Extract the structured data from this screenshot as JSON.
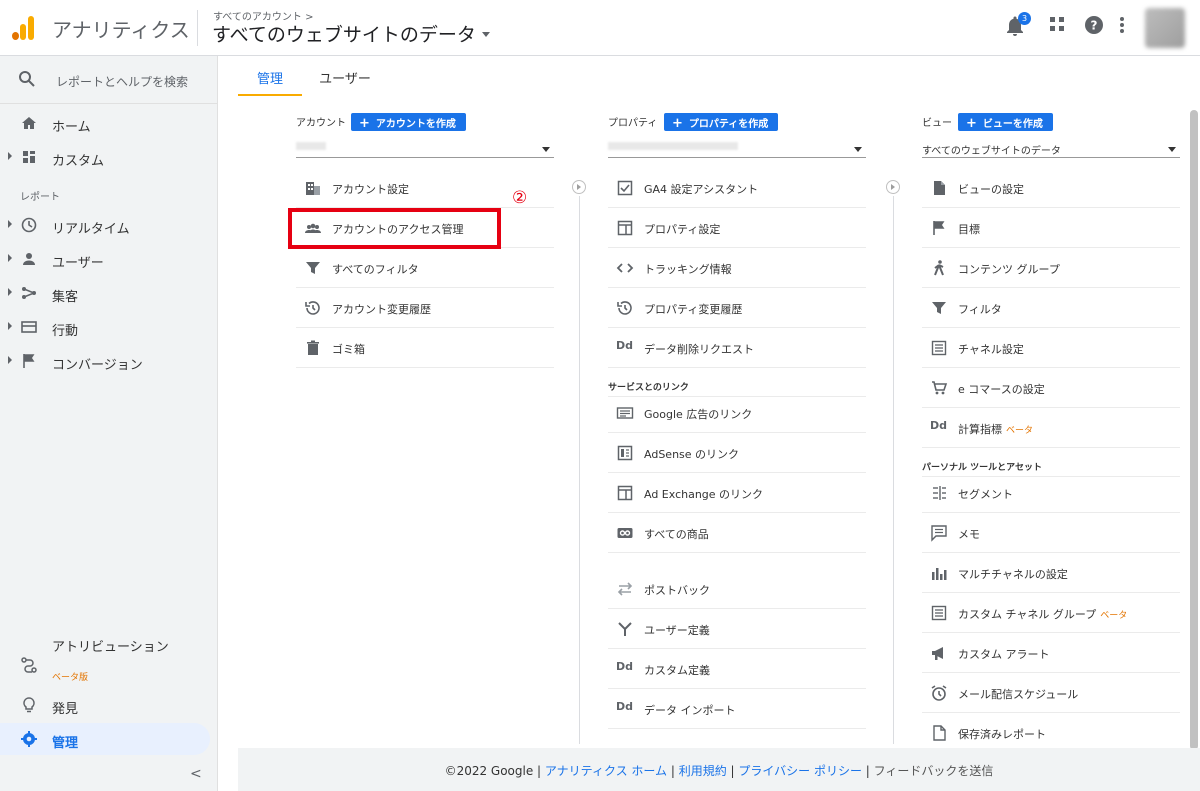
{
  "header": {
    "app_title": "アナリティクス",
    "breadcrumb": "すべてのアカウント >",
    "view_title": "すべてのウェブサイトのデータ",
    "notifications_count": "3",
    "colors": {
      "accent": "#1a73e8",
      "brand_orange": "#f9ab00",
      "brand_dark_orange": "#e37400"
    }
  },
  "sidebar": {
    "search_label": "レポートとヘルプを検索",
    "top_items": [
      {
        "label": "ホーム",
        "icon": "home-icon"
      },
      {
        "label": "カスタム",
        "icon": "dashboard-icon"
      }
    ],
    "reports_label": "レポート",
    "report_items": [
      {
        "label": "リアルタイム",
        "icon": "clock-icon"
      },
      {
        "label": "ユーザー",
        "icon": "person-icon"
      },
      {
        "label": "集客",
        "icon": "acquisition-icon"
      },
      {
        "label": "行動",
        "icon": "behavior-icon"
      },
      {
        "label": "コンバージョン",
        "icon": "flag-icon"
      }
    ],
    "attribution_label": "アトリビューション",
    "attribution_beta": "ベータ版",
    "discover_label": "発見",
    "admin_label": "管理",
    "collapse_label": "<"
  },
  "tabs": [
    {
      "label": "管理",
      "active": true
    },
    {
      "label": "ユーザー",
      "active": false
    }
  ],
  "account": {
    "heading": "アカウント",
    "create_label": "アカウントを作成",
    "items": [
      {
        "label": "アカウント設定",
        "icon": "building-icon"
      },
      {
        "label": "アカウントのアクセス管理",
        "icon": "people-icon"
      },
      {
        "label": "すべてのフィルタ",
        "icon": "filter-icon"
      },
      {
        "label": "アカウント変更履歴",
        "icon": "history-icon"
      },
      {
        "label": "ゴミ箱",
        "icon": "trash-icon"
      }
    ]
  },
  "property": {
    "heading": "プロパティ",
    "create_label": "プロパティを作成",
    "items": [
      {
        "label": "GA4 設定アシスタント",
        "icon": "checkbox-icon"
      },
      {
        "label": "プロパティ設定",
        "icon": "window-icon"
      },
      {
        "label": "トラッキング情報",
        "icon": "code-icon"
      },
      {
        "label": "プロパティ変更履歴",
        "icon": "history-icon"
      },
      {
        "label": "データ削除リクエスト",
        "icon": "dd-icon"
      }
    ],
    "links_heading": "サービスとのリンク",
    "link_items": [
      {
        "label": "Google 広告のリンク",
        "icon": "ads-icon"
      },
      {
        "label": "AdSense のリンク",
        "icon": "adsense-icon"
      },
      {
        "label": "Ad Exchange のリンク",
        "icon": "window-icon"
      },
      {
        "label": "すべての商品",
        "icon": "link-icon"
      }
    ],
    "more_items": [
      {
        "label": "ポストバック",
        "icon": "swap-icon"
      },
      {
        "label": "ユーザー定義",
        "icon": "fork-icon"
      },
      {
        "label": "カスタム定義",
        "icon": "dd-icon"
      },
      {
        "label": "データ インポート",
        "icon": "dd-icon"
      }
    ]
  },
  "view": {
    "heading": "ビュー",
    "create_label": "ビューを作成",
    "selected": "すべてのウェブサイトのデータ",
    "items": [
      {
        "label": "ビューの設定",
        "icon": "document-icon"
      },
      {
        "label": "目標",
        "icon": "flag-icon"
      },
      {
        "label": "コンテンツ グループ",
        "icon": "walker-icon"
      },
      {
        "label": "フィルタ",
        "icon": "filter-icon"
      },
      {
        "label": "チャネル設定",
        "icon": "channel-icon"
      },
      {
        "label": "e コマースの設定",
        "icon": "cart-icon"
      },
      {
        "label": "計算指標",
        "icon": "dd-icon",
        "beta": "ベータ"
      }
    ],
    "personal_heading": "パーソナル ツールとアセット",
    "personal_items": [
      {
        "label": "セグメント",
        "icon": "segment-icon"
      },
      {
        "label": "メモ",
        "icon": "comment-icon"
      },
      {
        "label": "マルチチャネルの設定",
        "icon": "bar-chart-icon"
      },
      {
        "label": "カスタム チャネル グループ",
        "icon": "channel-icon",
        "beta": "ベータ"
      },
      {
        "label": "カスタム アラート",
        "icon": "megaphone-icon"
      },
      {
        "label": "メール配信スケジュール",
        "icon": "alarm-icon"
      },
      {
        "label": "保存済みレポート",
        "icon": "file-icon"
      }
    ]
  },
  "annotation": {
    "number": "②"
  },
  "footer": {
    "copyright": "©2022 Google",
    "links": [
      "アナリティクス ホーム",
      "利用規約",
      "プライバシー ポリシー"
    ],
    "feedback": "フィードバックを送信"
  }
}
